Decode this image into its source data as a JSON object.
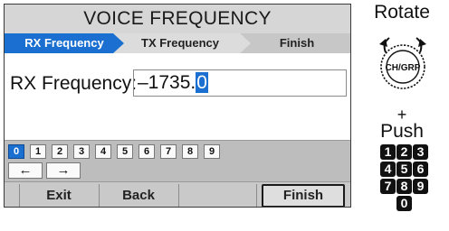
{
  "screen": {
    "title": "VOICE FREQUENCY",
    "steps": [
      "RX Frequency",
      "TX Frequency",
      "Finish"
    ],
    "field_label": "RX Frequency:",
    "field_value_prefix": "–1735.",
    "field_value_cursor": "0",
    "keypad_digits": [
      "0",
      "1",
      "2",
      "3",
      "4",
      "5",
      "6",
      "7",
      "8",
      "9"
    ],
    "selected_digit": "0",
    "arrow_left": "←",
    "arrow_right": "→",
    "softkeys": [
      "Exit",
      "Back",
      "",
      "Finish"
    ]
  },
  "instructions": {
    "rotate": "Rotate",
    "knob_label": "CH/GRP",
    "plus": "+",
    "push": "Push",
    "number_keys": [
      "1",
      "2",
      "3",
      "4",
      "5",
      "6",
      "7",
      "8",
      "9",
      "0"
    ]
  },
  "colors": {
    "accent": "#1a6fd0",
    "title_bg": "#d6d6d6",
    "bar_bg": "#c7c7c7"
  }
}
